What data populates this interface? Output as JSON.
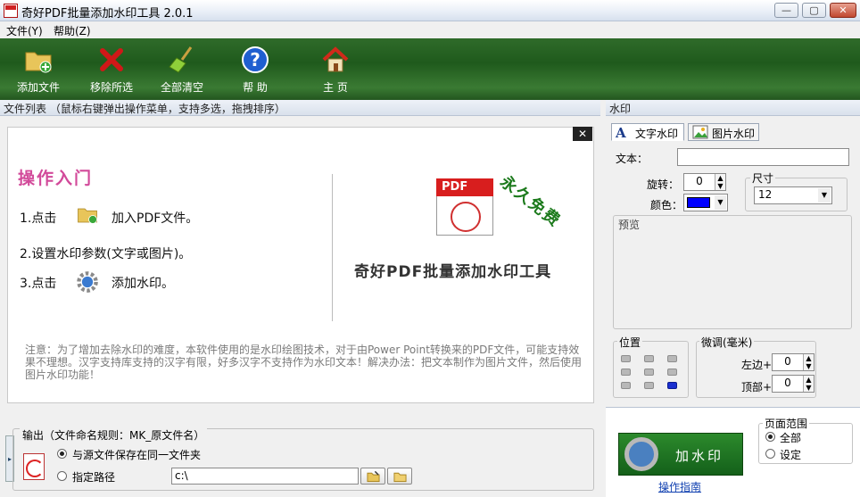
{
  "window": {
    "title": "奇好PDF批量添加水印工具 2.0.1",
    "controls": [
      "—",
      "▢",
      "✕"
    ]
  },
  "menu": [
    "文件(Y)",
    "帮助(Z)"
  ],
  "toolbar": [
    {
      "label": "添加文件",
      "icon": "folder-add-icon"
    },
    {
      "label": "移除所选",
      "icon": "red-x-icon"
    },
    {
      "label": "全部清空",
      "icon": "broom-icon"
    },
    {
      "label": "帮 助",
      "icon": "help-icon"
    },
    {
      "label": "主 页",
      "icon": "home-icon"
    }
  ],
  "file_list": {
    "header": "文件列表  （鼠标右键弹出操作菜单，支持多选，拖拽排序）",
    "close": "✕",
    "intro_title": "操作入门",
    "steps": [
      {
        "prefix": "1.点击",
        "text": "加入PDF文件。"
      },
      {
        "prefix": "2.设置水印参数(文字或图片)。",
        "text": ""
      },
      {
        "prefix": "3.点击",
        "text": "添加水印。"
      }
    ],
    "logo_text": "PDF",
    "free_stamp": "永久免费",
    "product_name": "奇好PDF批量添加水印工具",
    "notice": "注意：为了增加去除水印的难度，本软件使用的是水印绘图技术，对于由Power Point转换来的PDF文件，可能支持效果不理想。汉字支持库支持的汉字有限，好多汉字不支持作为水印文本！解决办法：把文本制作为图片文件，然后使用图片水印功能！"
  },
  "output": {
    "legend": "输出（文件命名规则：MK_原文件名）",
    "side_tab": "▸",
    "option_same": "与源文件保存在同一文件夹",
    "option_custom": "指定路径",
    "path_value": "c:\\"
  },
  "watermark": {
    "header": "水印",
    "tab_text": "文字水印",
    "tab_image": "图片水印",
    "text_label": "文本：",
    "text_value": "",
    "rotate_label": "旋转：",
    "rotate_value": "0",
    "color_label": "颜色：",
    "color_value": "#0000ff",
    "size_legend": "尺寸",
    "size_value": "12",
    "preview_label": "预览",
    "position_legend": "位置",
    "position_selected": "bottom-right",
    "offset_legend": "微调(毫米)",
    "left_label": "左边+",
    "left_value": "0",
    "top_label": "顶部+",
    "top_value": "0"
  },
  "apply": {
    "button": "加水印",
    "guide": "操作指南",
    "page_range_legend": "页面范围",
    "range_all": "全部",
    "range_set": "设定"
  }
}
